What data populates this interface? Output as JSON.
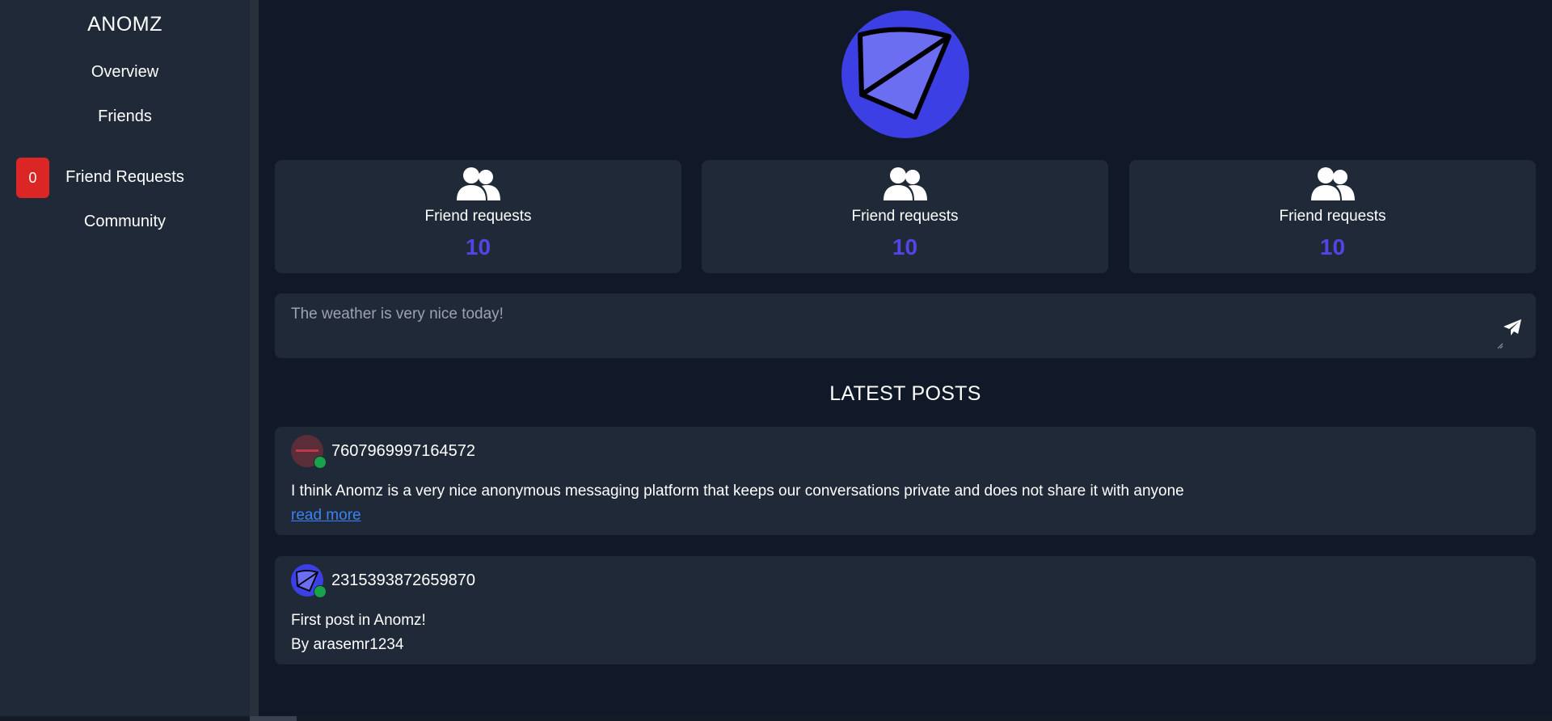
{
  "sidebar": {
    "brand": "ANOMZ",
    "items": [
      {
        "label": "Overview"
      },
      {
        "label": "Friends"
      },
      {
        "label": "Friend Requests",
        "badge": "0"
      },
      {
        "label": "Community"
      }
    ]
  },
  "stats": [
    {
      "label": "Friend requests",
      "value": "10",
      "icon": "users-icon"
    },
    {
      "label": "Friend requests",
      "value": "10",
      "icon": "users-icon"
    },
    {
      "label": "Friend requests",
      "value": "10",
      "icon": "users-icon"
    }
  ],
  "composer": {
    "placeholder": "The weather is very nice today!",
    "send_icon": "paper-plane-icon"
  },
  "posts_section": {
    "title": "LATEST POSTS",
    "posts": [
      {
        "author": "7607969997164572",
        "text": "I think Anomz is a very nice anonymous messaging platform that keeps our conversations private and does not share it with anyone",
        "link": "read more"
      },
      {
        "author": "2315393872659870",
        "text": "First post in Anomz!",
        "byline": "By arasemr1234"
      }
    ]
  },
  "colors": {
    "background": "#111827",
    "card": "#1f2937",
    "accent": "#4f46e5",
    "badge": "#dc2626",
    "online": "#16a34a",
    "link": "#3b82f6"
  }
}
